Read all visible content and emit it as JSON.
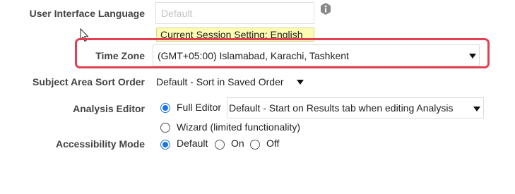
{
  "language": {
    "label": "User Interface Language",
    "value": "Default",
    "tooltip": "Current Session Setting: English",
    "info_icon": "info-icon"
  },
  "timezone": {
    "label": "Time Zone",
    "value": "(GMT+05:00) Islamabad, Karachi, Tashkent"
  },
  "sort_order": {
    "label": "Subject Area Sort Order",
    "value": "Default - Sort in Saved Order"
  },
  "analysis_editor": {
    "label": "Analysis Editor",
    "options": [
      "Full Editor",
      "Wizard (limited functionality)"
    ],
    "selected": "Full Editor",
    "editor_value": "Default - Start on Results tab when editing Analysis"
  },
  "accessibility": {
    "label": "Accessibility Mode",
    "options": [
      "Default",
      "On",
      "Off"
    ],
    "selected": "Default"
  },
  "colors": {
    "highlight": "#e0404f",
    "radio_accent": "#1a73e8",
    "tooltip_bg": "#fdfbb0"
  }
}
